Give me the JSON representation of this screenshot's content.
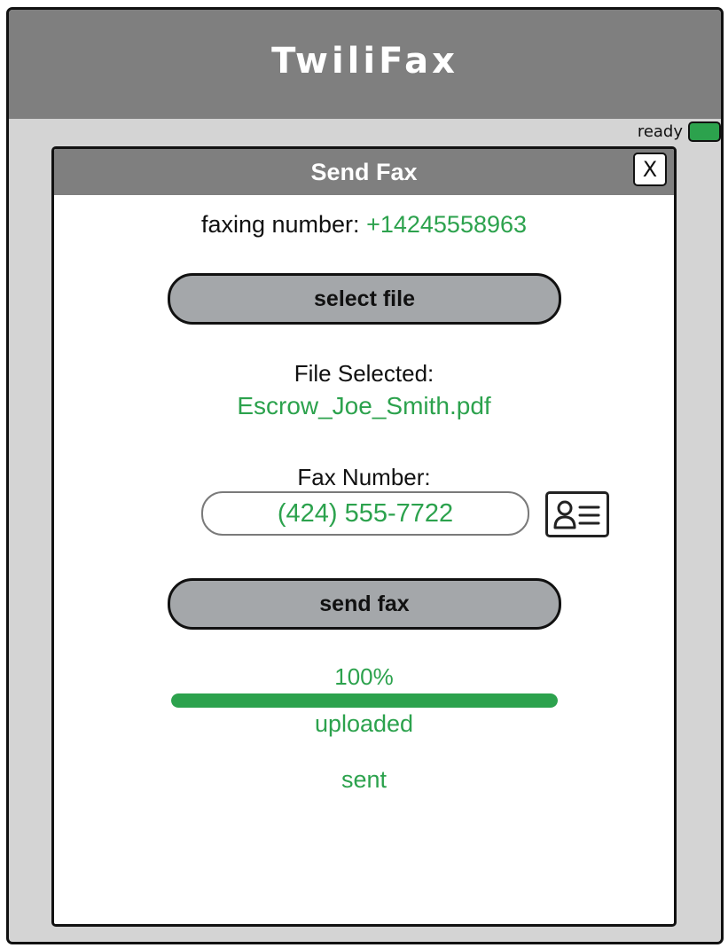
{
  "app": {
    "title": "TwiliFax",
    "status_text": "ready",
    "status_color": "#2ca24d"
  },
  "dialog": {
    "title": "Send Fax",
    "close_label": "X",
    "faxing_label": "faxing number:",
    "faxing_number": "+14245558963",
    "select_file_label": "select file",
    "file_selected_label": "File Selected:",
    "file_name": "Escrow_Joe_Smith.pdf",
    "fax_number_label": "Fax Number:",
    "fax_number_value": "(424) 555-7722",
    "contacts_icon": "contact-card-icon",
    "send_fax_label": "send fax",
    "progress_text": "100%",
    "progress_value": 1.0,
    "upload_status": "uploaded",
    "send_status": "sent"
  },
  "colors": {
    "accent": "#2ca24d",
    "header_gray": "#7f7f7f",
    "button_gray": "#a4a7aa",
    "background_gray": "#d4d4d4"
  }
}
